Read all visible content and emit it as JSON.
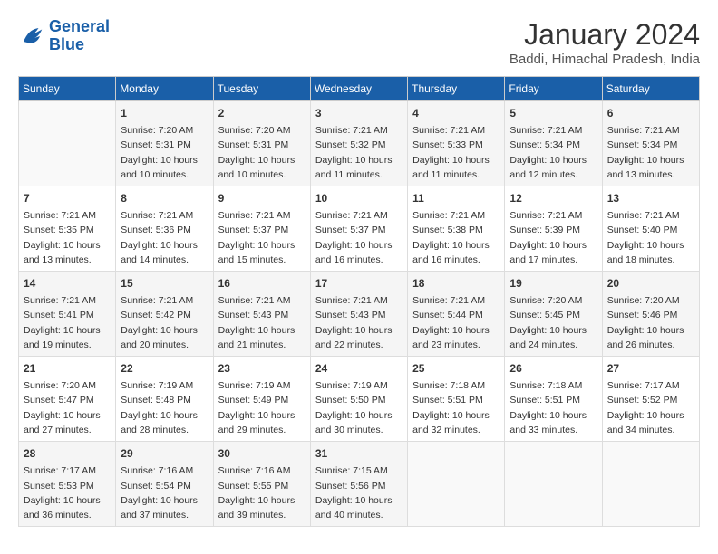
{
  "header": {
    "logo_line1": "General",
    "logo_line2": "Blue",
    "month_title": "January 2024",
    "location": "Baddi, Himachal Pradesh, India"
  },
  "weekdays": [
    "Sunday",
    "Monday",
    "Tuesday",
    "Wednesday",
    "Thursday",
    "Friday",
    "Saturday"
  ],
  "weeks": [
    [
      {
        "day": "",
        "info": ""
      },
      {
        "day": "1",
        "info": "Sunrise: 7:20 AM\nSunset: 5:31 PM\nDaylight: 10 hours\nand 10 minutes."
      },
      {
        "day": "2",
        "info": "Sunrise: 7:20 AM\nSunset: 5:31 PM\nDaylight: 10 hours\nand 10 minutes."
      },
      {
        "day": "3",
        "info": "Sunrise: 7:21 AM\nSunset: 5:32 PM\nDaylight: 10 hours\nand 11 minutes."
      },
      {
        "day": "4",
        "info": "Sunrise: 7:21 AM\nSunset: 5:33 PM\nDaylight: 10 hours\nand 11 minutes."
      },
      {
        "day": "5",
        "info": "Sunrise: 7:21 AM\nSunset: 5:34 PM\nDaylight: 10 hours\nand 12 minutes."
      },
      {
        "day": "6",
        "info": "Sunrise: 7:21 AM\nSunset: 5:34 PM\nDaylight: 10 hours\nand 13 minutes."
      }
    ],
    [
      {
        "day": "7",
        "info": "Sunrise: 7:21 AM\nSunset: 5:35 PM\nDaylight: 10 hours\nand 13 minutes."
      },
      {
        "day": "8",
        "info": "Sunrise: 7:21 AM\nSunset: 5:36 PM\nDaylight: 10 hours\nand 14 minutes."
      },
      {
        "day": "9",
        "info": "Sunrise: 7:21 AM\nSunset: 5:37 PM\nDaylight: 10 hours\nand 15 minutes."
      },
      {
        "day": "10",
        "info": "Sunrise: 7:21 AM\nSunset: 5:37 PM\nDaylight: 10 hours\nand 16 minutes."
      },
      {
        "day": "11",
        "info": "Sunrise: 7:21 AM\nSunset: 5:38 PM\nDaylight: 10 hours\nand 16 minutes."
      },
      {
        "day": "12",
        "info": "Sunrise: 7:21 AM\nSunset: 5:39 PM\nDaylight: 10 hours\nand 17 minutes."
      },
      {
        "day": "13",
        "info": "Sunrise: 7:21 AM\nSunset: 5:40 PM\nDaylight: 10 hours\nand 18 minutes."
      }
    ],
    [
      {
        "day": "14",
        "info": "Sunrise: 7:21 AM\nSunset: 5:41 PM\nDaylight: 10 hours\nand 19 minutes."
      },
      {
        "day": "15",
        "info": "Sunrise: 7:21 AM\nSunset: 5:42 PM\nDaylight: 10 hours\nand 20 minutes."
      },
      {
        "day": "16",
        "info": "Sunrise: 7:21 AM\nSunset: 5:43 PM\nDaylight: 10 hours\nand 21 minutes."
      },
      {
        "day": "17",
        "info": "Sunrise: 7:21 AM\nSunset: 5:43 PM\nDaylight: 10 hours\nand 22 minutes."
      },
      {
        "day": "18",
        "info": "Sunrise: 7:21 AM\nSunset: 5:44 PM\nDaylight: 10 hours\nand 23 minutes."
      },
      {
        "day": "19",
        "info": "Sunrise: 7:20 AM\nSunset: 5:45 PM\nDaylight: 10 hours\nand 24 minutes."
      },
      {
        "day": "20",
        "info": "Sunrise: 7:20 AM\nSunset: 5:46 PM\nDaylight: 10 hours\nand 26 minutes."
      }
    ],
    [
      {
        "day": "21",
        "info": "Sunrise: 7:20 AM\nSunset: 5:47 PM\nDaylight: 10 hours\nand 27 minutes."
      },
      {
        "day": "22",
        "info": "Sunrise: 7:19 AM\nSunset: 5:48 PM\nDaylight: 10 hours\nand 28 minutes."
      },
      {
        "day": "23",
        "info": "Sunrise: 7:19 AM\nSunset: 5:49 PM\nDaylight: 10 hours\nand 29 minutes."
      },
      {
        "day": "24",
        "info": "Sunrise: 7:19 AM\nSunset: 5:50 PM\nDaylight: 10 hours\nand 30 minutes."
      },
      {
        "day": "25",
        "info": "Sunrise: 7:18 AM\nSunset: 5:51 PM\nDaylight: 10 hours\nand 32 minutes."
      },
      {
        "day": "26",
        "info": "Sunrise: 7:18 AM\nSunset: 5:51 PM\nDaylight: 10 hours\nand 33 minutes."
      },
      {
        "day": "27",
        "info": "Sunrise: 7:17 AM\nSunset: 5:52 PM\nDaylight: 10 hours\nand 34 minutes."
      }
    ],
    [
      {
        "day": "28",
        "info": "Sunrise: 7:17 AM\nSunset: 5:53 PM\nDaylight: 10 hours\nand 36 minutes."
      },
      {
        "day": "29",
        "info": "Sunrise: 7:16 AM\nSunset: 5:54 PM\nDaylight: 10 hours\nand 37 minutes."
      },
      {
        "day": "30",
        "info": "Sunrise: 7:16 AM\nSunset: 5:55 PM\nDaylight: 10 hours\nand 39 minutes."
      },
      {
        "day": "31",
        "info": "Sunrise: 7:15 AM\nSunset: 5:56 PM\nDaylight: 10 hours\nand 40 minutes."
      },
      {
        "day": "",
        "info": ""
      },
      {
        "day": "",
        "info": ""
      },
      {
        "day": "",
        "info": ""
      }
    ]
  ]
}
